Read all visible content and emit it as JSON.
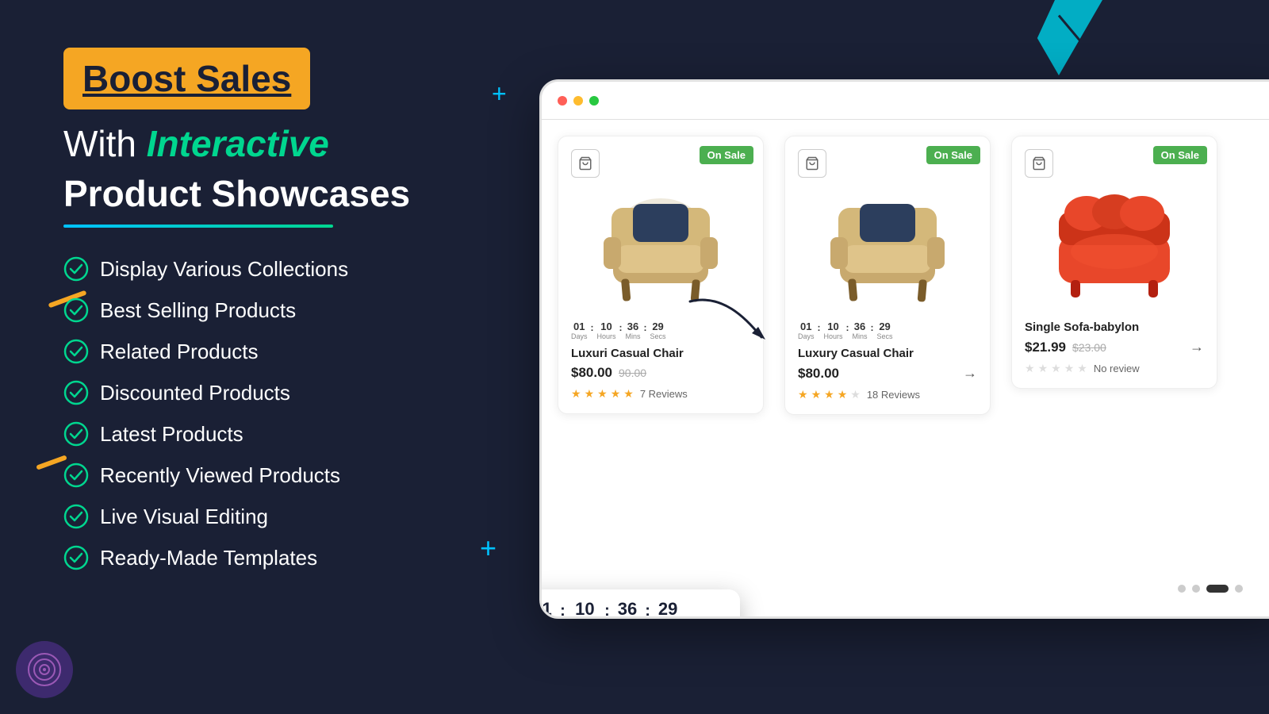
{
  "page": {
    "background_color": "#1a2035"
  },
  "hero": {
    "badge_text": "Boost Sales",
    "headline_with": "With",
    "headline_interactive": "Interactive",
    "headline_product": "Product Showcases"
  },
  "features": [
    {
      "id": 1,
      "label": "Display Various Collections"
    },
    {
      "id": 2,
      "label": "Best Selling Products"
    },
    {
      "id": 3,
      "label": "Related Products"
    },
    {
      "id": 4,
      "label": "Discounted Products"
    },
    {
      "id": 5,
      "label": "Latest Products"
    },
    {
      "id": 6,
      "label": "Recently Viewed Products"
    },
    {
      "id": 7,
      "label": "Live Visual Editing"
    },
    {
      "id": 8,
      "label": "Ready-Made Templates"
    }
  ],
  "products": [
    {
      "id": 1,
      "name": "Luxuri Casual Chair",
      "price": "$80.00",
      "old_price": "90.00",
      "on_sale": true,
      "stars": 5,
      "reviews": "7 Reviews",
      "color": "beige",
      "has_countdown": true
    },
    {
      "id": 2,
      "name": "Luxury Casual Chair",
      "price": "$80.00",
      "old_price": "",
      "on_sale": true,
      "stars": 3.5,
      "reviews": "18 Reviews",
      "color": "beige",
      "has_countdown": true
    },
    {
      "id": 3,
      "name": "Single Sofa-babylon",
      "price": "$21.99",
      "old_price": "$23.00",
      "on_sale": true,
      "stars": 0,
      "reviews": "No review",
      "color": "red",
      "has_countdown": false
    }
  ],
  "countdown": {
    "days_num": "01",
    "days_label": "Days",
    "hours_num": "10",
    "hours_label": "Hours",
    "mins_num": "36",
    "mins_label": "Mins",
    "secs_num": "29",
    "secs_label": "Secs"
  },
  "pagination": {
    "dots": [
      false,
      false,
      true,
      false
    ]
  },
  "logo": {
    "target_icon": "🎯"
  },
  "labels": {
    "on_sale": "On Sale"
  }
}
